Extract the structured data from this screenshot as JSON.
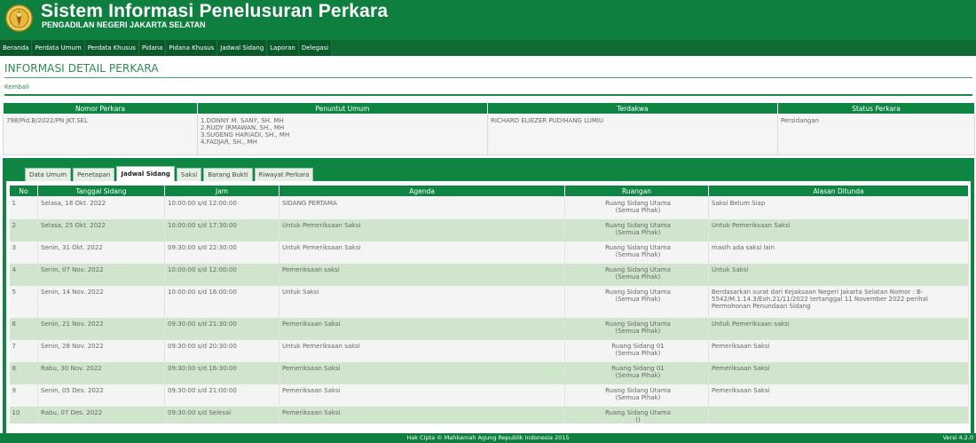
{
  "header": {
    "title": "Sistem Informasi Penelusuran Perkara",
    "subtitle": "PENGADILAN NEGERI JAKARTA SELATAN"
  },
  "menu": [
    "Beranda",
    "Perdata Umum",
    "Perdata Khusus",
    "Pidana",
    "Pidana Khusus",
    "Jadwal Sidang",
    "Laporan",
    "Delegasi"
  ],
  "page": {
    "heading": "INFORMASI DETAIL PERKARA",
    "back_label": "Kembali"
  },
  "case_info": {
    "headers": [
      "Nomor Perkara",
      "Penuntut Umum",
      "Terdakwa",
      "Status Perkara"
    ],
    "nomor_perkara": "798/Pid.B/2022/PN JKT.SEL",
    "penuntut_umum": [
      "1.DONNY M. SANY, SH. MH",
      "2.RUDY IRMAWAN, SH., MH",
      "3.SUGENG HARIADI, SH., MH",
      "4.FADJAR, SH., MH"
    ],
    "terdakwa": "RICHARD ELIEZER PUDIHANG LUMIU",
    "status": "Persidangan"
  },
  "tabs": [
    "Data Umum",
    "Penetapan",
    "Jadwal Sidang",
    "Saksi",
    "Barang Bukti",
    "Riwayat Perkara"
  ],
  "active_tab": "Jadwal Sidang",
  "schedule": {
    "headers": [
      "No",
      "Tanggal Sidang",
      "Jam",
      "Agenda",
      "Ruangan",
      "Alasan Ditunda"
    ],
    "rows": [
      {
        "no": "1",
        "tanggal": "Selasa, 18 Okt. 2022",
        "jam": "10:00:00 s/d 12:00:00",
        "agenda": "SIDANG PERTAMA",
        "ruangan": [
          "Ruang Sidang Utama",
          "(Semua Pihak)"
        ],
        "alasan": [
          "Saksi Belum Siap"
        ]
      },
      {
        "no": "2",
        "tanggal": "Selasa, 25 Okt. 2022",
        "jam": "10:00:00 s/d 17:30:00",
        "agenda": "Untuk Pemeriksaan Saksi",
        "ruangan": [
          "Ruang Sidang Utama",
          "(Semua Pihak)"
        ],
        "alasan": [
          "Untuk Pemeriksaan Saksi"
        ]
      },
      {
        "no": "3",
        "tanggal": "Senin, 31 Okt. 2022",
        "jam": "09:30:00 s/d 22:30:00",
        "agenda": "Untuk Pemeriksaan Saksi",
        "ruangan": [
          "Ruang Sidang Utama",
          "(Semua Pihak)"
        ],
        "alasan": [
          "masih ada saksi lain"
        ]
      },
      {
        "no": "4",
        "tanggal": "Senin, 07 Nov. 2022",
        "jam": "10:00:00 s/d 12:00:00",
        "agenda": "Pemeriksaan saksi",
        "ruangan": [
          "Ruang Sidang Utama",
          "(Semua Pihak)"
        ],
        "alasan": [
          "Untuk Saksi"
        ]
      },
      {
        "no": "5",
        "tanggal": "Senin, 14 Nov. 2022",
        "jam": "10:00:00 s/d 16:00:00",
        "agenda": "Untuk Saksi",
        "ruangan": [
          "Ruang Sidang Utama",
          "(Semua Pihak)"
        ],
        "alasan": [
          "Berdasarkan surat dari Kejaksaan Negeri Jakarta Selatan Nomor : B-",
          "5542/M.1.14.3/Eoh.21/11/2022 tertanggal 11 November 2022 perihal",
          "Permohonan Penundaan Sidang"
        ]
      },
      {
        "no": "6",
        "tanggal": "Senin, 21 Nov. 2022",
        "jam": "09:30:00 s/d 21:30:00",
        "agenda": "Pemeriksaan Saksi",
        "ruangan": [
          "Ruang Sidang Utama",
          "(Semua Pihak)"
        ],
        "alasan": [
          "Untuk Pemeriksaan saksi"
        ]
      },
      {
        "no": "7",
        "tanggal": "Senin, 28 Nov. 2022",
        "jam": "09:30:00 s/d 20:30:00",
        "agenda": "Untuk Pemeriksaan saksi",
        "ruangan": [
          "Ruang Sidang 01",
          "(Semua Pihak)"
        ],
        "alasan": [
          "Pemeriksaan Saksi"
        ]
      },
      {
        "no": "8",
        "tanggal": "Rabu, 30 Nov. 2022",
        "jam": "09:30:00 s/d 16:30:00",
        "agenda": "Pemeriksaan Saksi",
        "ruangan": [
          "Ruang Sidang 01",
          "(Semua Pihak)"
        ],
        "alasan": [
          "Pemeriksaan Saksi"
        ]
      },
      {
        "no": "9",
        "tanggal": "Senin, 05 Des. 2022",
        "jam": "09:30:00 s/d 21:00:00",
        "agenda": "Pemeriksaan Saksi",
        "ruangan": [
          "Ruang Sidang Utama",
          "(Semua Pihak)"
        ],
        "alasan": [
          "Pemeriksaan Saksi"
        ]
      },
      {
        "no": "10",
        "tanggal": "Rabu, 07 Des. 2022",
        "jam": "09:30:00 s/d Selesai",
        "agenda": "Pemeriksaan Saksi",
        "ruangan": [
          "Ruang Sidang Utama",
          "()"
        ],
        "alasan": []
      }
    ]
  },
  "footer": {
    "copyright": "Hak Cipta © Mahkamah Agung Republik Indonesia 2015",
    "version": "Versi 4.2.0"
  },
  "icons": {
    "logo": "court-emblem-icon"
  },
  "colors": {
    "primary_green": "#0f7f3f",
    "row_green": "#cfe6cc",
    "heading_green": "#2e8b4e"
  }
}
